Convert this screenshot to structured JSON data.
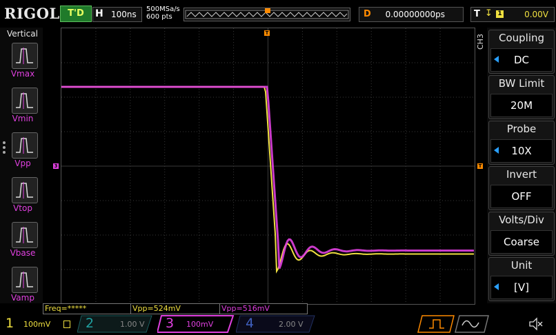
{
  "header": {
    "logo": "RIGOL",
    "run_state": "T'D",
    "timebase_label": "H",
    "timebase": "100ns",
    "sample_rate": "500MSa/s",
    "memory_depth": "600  pts",
    "delay_label": "D",
    "delay": "0.00000000ps",
    "trigger_label": "T",
    "trigger_source": "1",
    "trigger_level": "0.00V"
  },
  "left_menu": {
    "title": "Vertical",
    "items": [
      {
        "label": "Vmax",
        "icon": "vmax-icon"
      },
      {
        "label": "Vmin",
        "icon": "vmin-icon"
      },
      {
        "label": "Vpp",
        "icon": "vpp-icon"
      },
      {
        "label": "Vtop",
        "icon": "vtop-icon"
      },
      {
        "label": "Vbase",
        "icon": "vbase-icon"
      },
      {
        "label": "Vamp",
        "icon": "vamp-icon"
      }
    ]
  },
  "right_menu": {
    "channel_tag": "CH3",
    "items": [
      {
        "title": "Coupling",
        "value": "DC",
        "has_arrow": true
      },
      {
        "title": "BW Limit",
        "value": "20M",
        "has_arrow": false
      },
      {
        "title": "Probe",
        "value": "10X",
        "has_arrow": true
      },
      {
        "title": "Invert",
        "value": "OFF",
        "has_arrow": false
      },
      {
        "title": "Volts/Div",
        "value": "Coarse",
        "has_arrow": false
      },
      {
        "title": "Unit",
        "value": "[V]",
        "has_arrow": true
      }
    ]
  },
  "measurements": [
    {
      "text": "Freq=*****",
      "color": "#f0e040"
    },
    {
      "text": "Vpp=524mV",
      "color": "#f0e040"
    },
    {
      "text": "Vpp=516mV",
      "color": "#e040e0"
    }
  ],
  "markers": {
    "channel3_ref": "3",
    "trigger_pos": "T",
    "trigger_level": "T"
  },
  "channels": [
    {
      "num": "1",
      "scale": "100mV",
      "color": "#f0e040",
      "active": true
    },
    {
      "num": "2",
      "scale": "1.00 V",
      "color": "#20c0c0",
      "active": false
    },
    {
      "num": "3",
      "scale": "100mV",
      "color": "#e040e0",
      "active": true
    },
    {
      "num": "4",
      "scale": "2.00 V",
      "color": "#3070ff",
      "active": false
    }
  ],
  "colors": {
    "ch1": "#f0e040",
    "ch3": "#e040e0",
    "accent_orange": "#ff8a00",
    "grid": "#3a3a3a"
  },
  "waveforms": {
    "ch1_high_div": 2.3,
    "ch1_low_div": -2.55,
    "ch3_high_div": 2.3,
    "ch3_low_div": -2.45,
    "edge_time_div": 0.0
  }
}
